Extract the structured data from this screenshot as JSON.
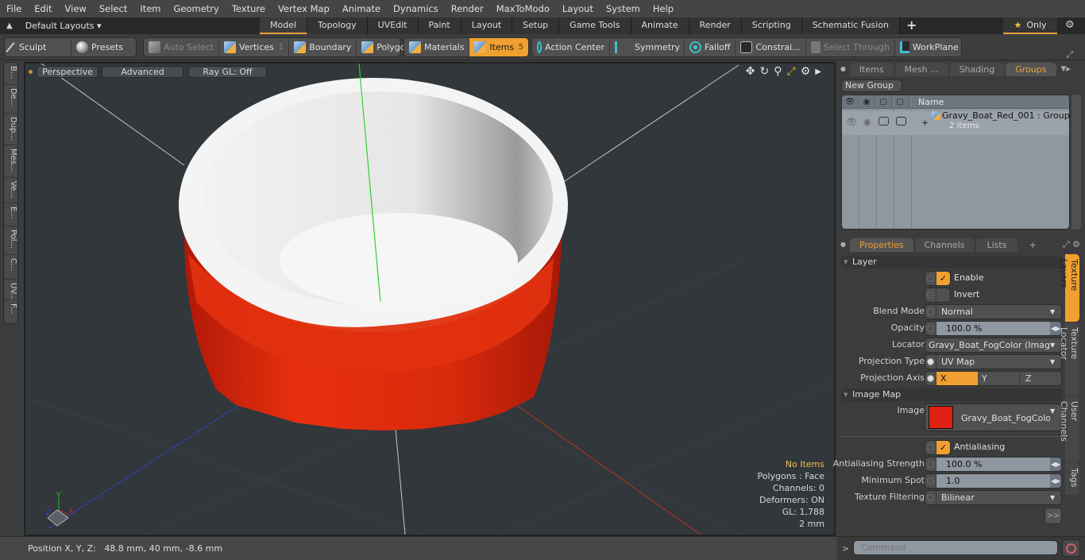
{
  "menu": [
    "File",
    "Edit",
    "View",
    "Select",
    "Item",
    "Geometry",
    "Texture",
    "Vertex Map",
    "Animate",
    "Dynamics",
    "Render",
    "MaxToModo",
    "Layout",
    "System",
    "Help"
  ],
  "layout_dropdown": "Default Layouts ▾",
  "tabs": [
    {
      "label": "Model",
      "active": true
    },
    {
      "label": "Topology"
    },
    {
      "label": "UVEdit"
    },
    {
      "label": "Paint"
    },
    {
      "label": "Layout"
    },
    {
      "label": "Setup"
    },
    {
      "label": "Game Tools"
    },
    {
      "label": "Animate"
    },
    {
      "label": "Render"
    },
    {
      "label": "Scripting"
    },
    {
      "label": "Schematic Fusion"
    }
  ],
  "tab_add": "+",
  "only_button": "Only",
  "toolbar": {
    "sculpt": "Sculpt",
    "presets": "Presets",
    "auto_select": "Auto Select",
    "vertices": "Vertices",
    "vertices_count": "1",
    "boundary": "Boundary",
    "polygons": "Polygons",
    "materials": "Materials",
    "items": "Items",
    "items_count": "5",
    "action_center": "Action Center",
    "symmetry": "Symmetry",
    "falloff": "Falloff",
    "constraints": "Constrai...",
    "select_through": "Select Through",
    "workplane": "WorkPlane"
  },
  "left_tabs": [
    "B...",
    "De...",
    "Dup...",
    "Mes...",
    "Ve...",
    "E...",
    "Pol...",
    "C...",
    "UV...",
    "F..."
  ],
  "viewport": {
    "view_mode": "Perspective",
    "advanced": "Advanced",
    "raygl": "Ray GL: Off",
    "info": {
      "selection": "No Items",
      "polygons": "Polygons : Face",
      "channels": "Channels: 0",
      "deformers": "Deformers: ON",
      "gl": "GL: 1,788",
      "unit": "2 mm"
    },
    "object_colors": {
      "outer": "#e02a10",
      "inner": "#ececec"
    }
  },
  "status": {
    "position_label": "Position X, Y, Z:",
    "position_value": "48.8 mm, 40 mm, -8.6 mm"
  },
  "top_panel": {
    "tabs": [
      {
        "label": "Items"
      },
      {
        "label": "Mesh ..."
      },
      {
        "label": "Shading"
      },
      {
        "label": "Groups",
        "active": true
      }
    ],
    "new_group": "New Group",
    "column_name": "Name",
    "group": {
      "name": "Gravy_Boat_Red_001 : Group",
      "count": "2 Items"
    }
  },
  "properties": {
    "tabs": [
      {
        "label": "Properties",
        "active": true
      },
      {
        "label": "Channels"
      },
      {
        "label": "Lists"
      },
      {
        "label": "+"
      }
    ],
    "layer_section": "Layer",
    "enable": {
      "label": "Enable",
      "checked": true
    },
    "invert": {
      "label": "Invert",
      "checked": false
    },
    "blend_mode": {
      "label": "Blend Mode",
      "value": "Normal"
    },
    "opacity": {
      "label": "Opacity",
      "value": "100.0 %"
    },
    "locator": {
      "label": "Locator",
      "value": "Gravy_Boat_FogColor (Imag ..."
    },
    "projection_type": {
      "label": "Projection Type",
      "value": "UV Map"
    },
    "projection_axis": {
      "label": "Projection Axis",
      "options": [
        "X",
        "Y",
        "Z"
      ],
      "selected": "X"
    },
    "image_map_section": "Image Map",
    "image": {
      "label": "Image",
      "value": "Gravy_Boat_FogColor",
      "swatch": "#e02010"
    },
    "antialiasing": {
      "label": "Antialiasing",
      "checked": true
    },
    "aa_strength": {
      "label": "Antialiasing Strength",
      "value": "100.0 %"
    },
    "min_spot": {
      "label": "Minimum Spot",
      "value": "1.0"
    },
    "filtering": {
      "label": "Texture Filtering",
      "value": "Bilinear"
    },
    "more": ">>",
    "side_tabs": [
      {
        "label": "Texture Layers",
        "active": true
      },
      {
        "label": "Texture Locator"
      },
      {
        "label": "User Channels"
      },
      {
        "label": "Tags"
      }
    ]
  },
  "command": {
    "prompt": ">",
    "placeholder": "Command"
  }
}
